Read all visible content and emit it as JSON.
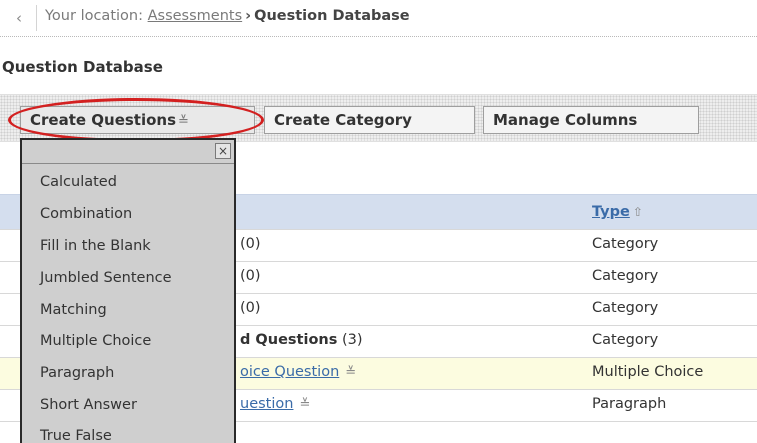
{
  "breadcrumb": {
    "back_icon": "chevron-left-icon",
    "prefix": "Your location:",
    "link": "Assessments",
    "separator": "›",
    "current": "Question Database"
  },
  "page_title": "Question Database",
  "toolbar": {
    "create_questions": "Create Questions",
    "create_category": "Create Category",
    "manage_columns": "Manage Columns",
    "menu_caret": "≚"
  },
  "dropdown": {
    "close": "×",
    "items": [
      "Calculated",
      "Combination",
      "Fill in the Blank",
      "Jumbled Sentence",
      "Matching",
      "Multiple Choice",
      "Paragraph",
      "Short Answer",
      "True False"
    ]
  },
  "table": {
    "header_type": "Type",
    "sort_icon": "⇧",
    "rows": [
      {
        "name_prefix": "",
        "name": "(0)",
        "type": "Category"
      },
      {
        "name_prefix": "",
        "name": "(0)",
        "type": "Category"
      },
      {
        "name_prefix": "",
        "name": "(0)",
        "type": "Category"
      },
      {
        "name_prefix": "d Questions",
        "name": "(3)",
        "type": "Category"
      },
      {
        "link": "oice Question",
        "caret": "≚",
        "type": "Multiple Choice"
      },
      {
        "link": "uestion",
        "caret": "≚",
        "type": "Paragraph"
      }
    ]
  },
  "colors": {
    "accent": "#3a6ba8",
    "header_bg": "#d4deee",
    "highlight": "#d32020",
    "row_highlight": "#fcfce0"
  }
}
